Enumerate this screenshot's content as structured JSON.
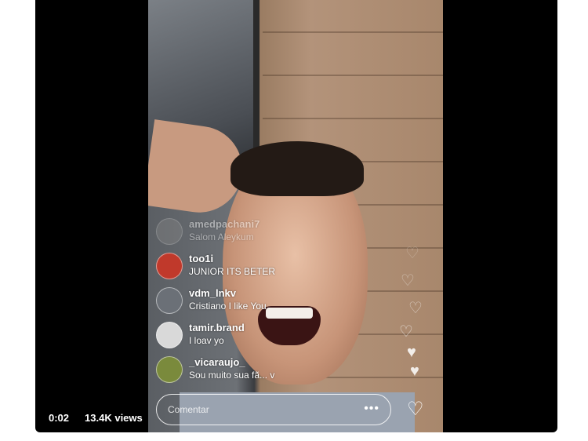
{
  "video": {
    "time": "0:02",
    "views": "13.4K views"
  },
  "live": {
    "comments": [
      {
        "user": "amedpachani7",
        "message": "Salom Aleykum",
        "avatar_color": "#888888",
        "faded": true
      },
      {
        "user": "too1i",
        "message": "JUNIOR ITS BETER",
        "avatar_color": "#c0392b",
        "faded": false
      },
      {
        "user": "vdm_lnkv",
        "message": "Cristiano I like You",
        "avatar_color": "#6b7077",
        "faded": false
      },
      {
        "user": "tamir.brand",
        "message": "I loav yo",
        "avatar_color": "#d9d9d9",
        "faded": false
      },
      {
        "user": "_vicaraujo_",
        "message": "Sou muito sua fã... v",
        "avatar_color": "#7a8a3c",
        "faded": false
      }
    ],
    "comment_placeholder": "Comentar",
    "more_icon": "more-icon",
    "like_icon": "heart-icon"
  }
}
